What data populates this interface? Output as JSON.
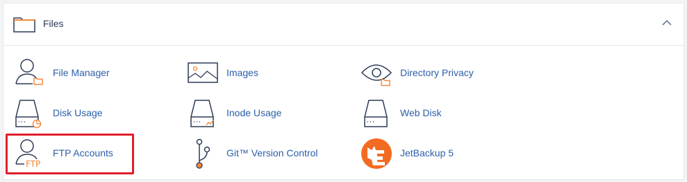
{
  "section": {
    "title": "Files",
    "folder_icon": "folder-icon",
    "collapse_icon": "chevron-up-icon"
  },
  "items": [
    {
      "label": "File Manager",
      "icon": "file-manager-icon"
    },
    {
      "label": "Images",
      "icon": "images-icon"
    },
    {
      "label": "Directory Privacy",
      "icon": "directory-privacy-icon"
    },
    {
      "label": "Disk Usage",
      "icon": "disk-usage-icon"
    },
    {
      "label": "Inode Usage",
      "icon": "inode-usage-icon"
    },
    {
      "label": "Web Disk",
      "icon": "web-disk-icon"
    },
    {
      "label": "FTP Accounts",
      "icon": "ftp-accounts-icon",
      "icon_text": "FTP"
    },
    {
      "label": "Git™ Version Control",
      "icon": "git-version-control-icon"
    },
    {
      "label": "JetBackup 5",
      "icon": "jetbackup-icon"
    }
  ],
  "highlighted_item": "FTP Accounts",
  "colors": {
    "text": "#2b3a55",
    "link": "#2b5fa8",
    "accent": "#f0883a",
    "jetbackup": "#f36b22",
    "highlight": "#e11d2a"
  }
}
